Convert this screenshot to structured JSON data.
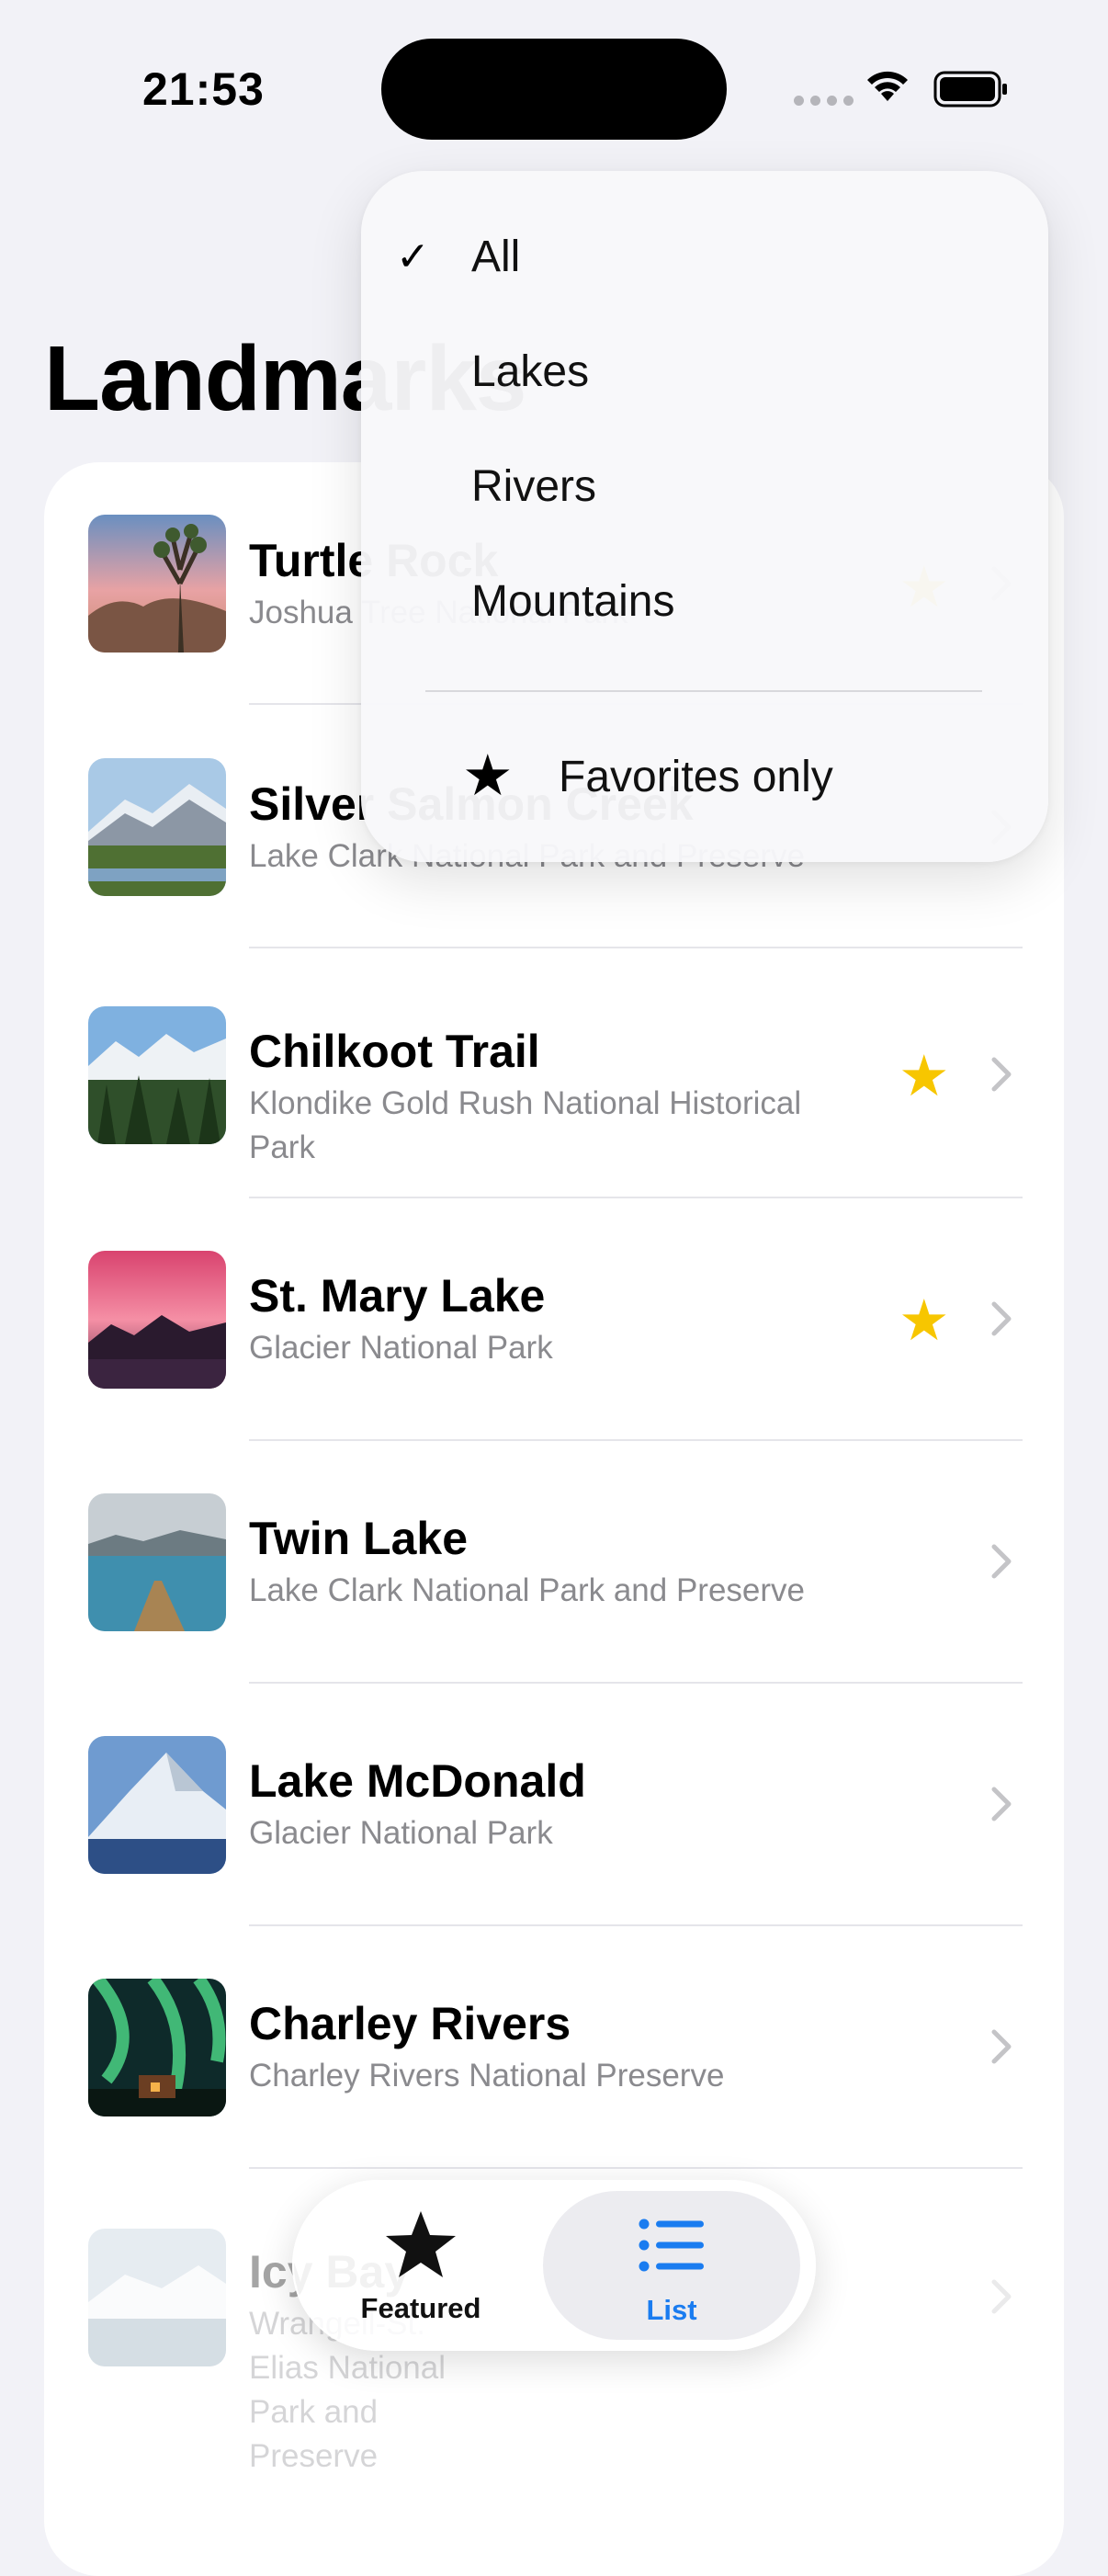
{
  "status_bar": {
    "time": "21:53"
  },
  "header": {
    "title": "Landmarks"
  },
  "filter_menu": {
    "items": [
      {
        "label": "All",
        "checked": true
      },
      {
        "label": "Lakes",
        "checked": false
      },
      {
        "label": "Rivers",
        "checked": false
      },
      {
        "label": "Mountains",
        "checked": false
      }
    ],
    "favorites_label": "Favorites only"
  },
  "landmarks": [
    {
      "name": "Turtle Rock",
      "park": "Joshua Tree National Park",
      "favorite": true
    },
    {
      "name": "Silver Salmon Creek",
      "park": "Lake Clark National Park and Preserve",
      "favorite": false
    },
    {
      "name": "Chilkoot Trail",
      "park": "Klondike Gold Rush National Historical Park",
      "favorite": true
    },
    {
      "name": "St. Mary Lake",
      "park": "Glacier National Park",
      "favorite": true
    },
    {
      "name": "Twin Lake",
      "park": "Lake Clark National Park and Preserve",
      "favorite": false
    },
    {
      "name": "Lake McDonald",
      "park": "Glacier National Park",
      "favorite": false
    },
    {
      "name": "Charley Rivers",
      "park": "Charley Rivers National Preserve",
      "favorite": false
    },
    {
      "name": "Icy Bay",
      "park": "Wrangell-St. Elias National Park and Preserve",
      "favorite": false
    }
  ],
  "tab_bar": {
    "tabs": [
      {
        "label": "Featured",
        "icon": "star-icon",
        "selected": false
      },
      {
        "label": "List",
        "icon": "list-icon",
        "selected": true
      }
    ]
  },
  "colors": {
    "accent": "#1a7cf0",
    "favorite": "#f7c600",
    "background": "#f2f2f7"
  }
}
